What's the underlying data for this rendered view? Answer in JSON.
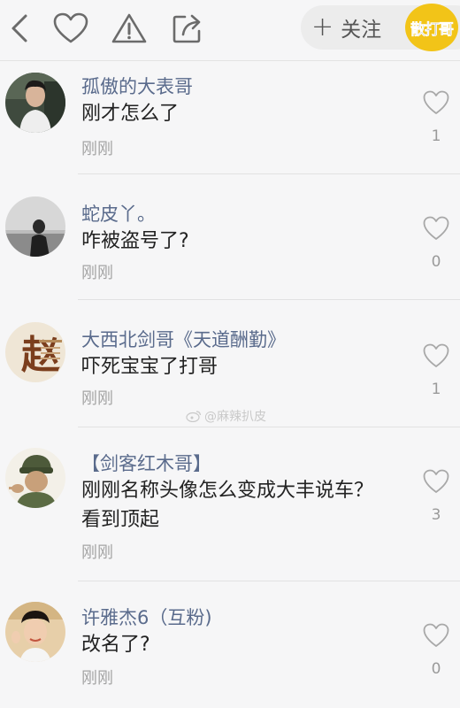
{
  "toolbar": {
    "follow_label": "关注",
    "brand_text": "散打哥"
  },
  "comments": [
    {
      "name": "孤傲的大表哥",
      "text": "刚才怎么了",
      "time": "刚刚",
      "likes": "1"
    },
    {
      "name": "蛇皮丫。",
      "text": "咋被盗号了?",
      "time": "刚刚",
      "likes": "0"
    },
    {
      "name": "大西北剑哥《天道酬勤》",
      "text": "吓死宝宝了打哥",
      "time": "刚刚",
      "likes": "1",
      "avatar_glyph": "赵"
    },
    {
      "name": "【剑客红木哥】",
      "text": "刚刚名称头像怎么变成大丰说车？看到顶起",
      "time": "刚刚",
      "likes": "3"
    },
    {
      "name": "许雅杰6（互粉)",
      "text": "改名了?",
      "time": "刚刚",
      "likes": "0"
    }
  ],
  "watermark": "@麻辣扒皮",
  "colors": {
    "name": "#5a6b8c",
    "brand": "#f2c418",
    "background": "#f6f6f7"
  }
}
